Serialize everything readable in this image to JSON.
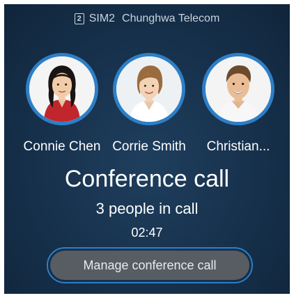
{
  "status_bar": {
    "sim_badge": "2",
    "sim_label": "SIM2",
    "carrier": "Chunghwa Telecom"
  },
  "participants": [
    {
      "name": "Connie Chen",
      "avatar_icon": "woman-avatar"
    },
    {
      "name": "Corrie Smith",
      "avatar_icon": "woman-avatar"
    },
    {
      "name": "Christian...",
      "avatar_icon": "man-avatar"
    }
  ],
  "call": {
    "title": "Conference call",
    "subtitle": "3 people in call",
    "timer": "02:47"
  },
  "actions": {
    "manage_label": "Manage conference call"
  },
  "colors": {
    "accent": "#2d7fc6",
    "background": "#18334f",
    "button": "#585d63"
  }
}
